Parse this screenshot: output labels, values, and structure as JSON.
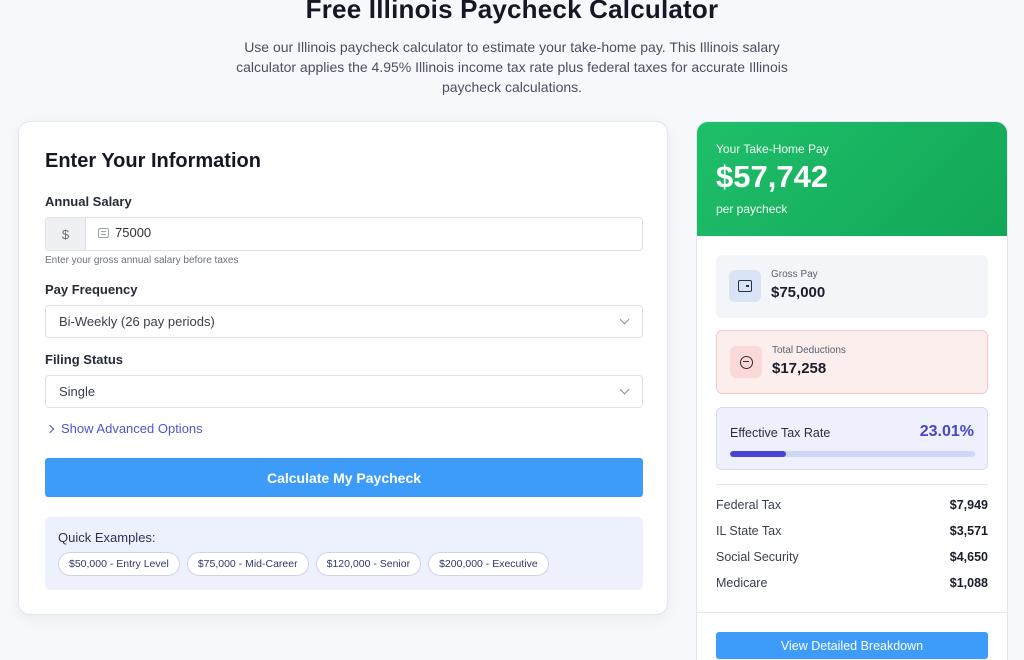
{
  "header": {
    "title": "Free Illinois Paycheck Calculator",
    "subtitle": "Use our Illinois paycheck calculator to estimate your take-home pay. This Illinois salary calculator applies the 4.95% Illinois income tax rate plus federal taxes for accurate Illinois paycheck calculations."
  },
  "form": {
    "title": "Enter Your Information",
    "salary_label": "Annual Salary",
    "salary_prefix": "$",
    "salary_value": "75000",
    "salary_hint": "Enter your gross annual salary before taxes",
    "frequency_label": "Pay Frequency",
    "frequency_value": "Bi-Weekly (26 pay periods)",
    "filing_label": "Filing Status",
    "filing_value": "Single",
    "advanced_label": "Show Advanced Options",
    "calculate_label": "Calculate My Paycheck",
    "quick_label": "Quick Examples:",
    "quick_examples": [
      "$50,000 - Entry Level",
      "$75,000 - Mid-Career",
      "$120,000 - Senior",
      "$200,000 - Executive"
    ]
  },
  "result": {
    "takehome_label": "Your Take-Home Pay",
    "takehome_amount": "$57,742",
    "takehome_period": "per paycheck",
    "gross_label": "Gross Pay",
    "gross_value": "$75,000",
    "deductions_label": "Total Deductions",
    "deductions_value": "$17,258",
    "rate_label": "Effective Tax Rate",
    "rate_value": "23.01%",
    "rate_fraction": 0.2301,
    "taxes": [
      {
        "name": "Federal Tax",
        "value": "$7,949"
      },
      {
        "name": "IL State Tax",
        "value": "$3,571"
      },
      {
        "name": "Social Security",
        "value": "$4,650"
      },
      {
        "name": "Medicare",
        "value": "$1,088"
      }
    ],
    "detail_button": "View Detailed Breakdown"
  },
  "colors": {
    "accent_blue": "#3d9cfa",
    "success_green": "#1fbf6a",
    "rate_purple": "#4a44d6"
  },
  "icons": {
    "gross": "wallet-icon",
    "deductions": "minus-circle-icon",
    "salary": "keyboard-icon"
  }
}
